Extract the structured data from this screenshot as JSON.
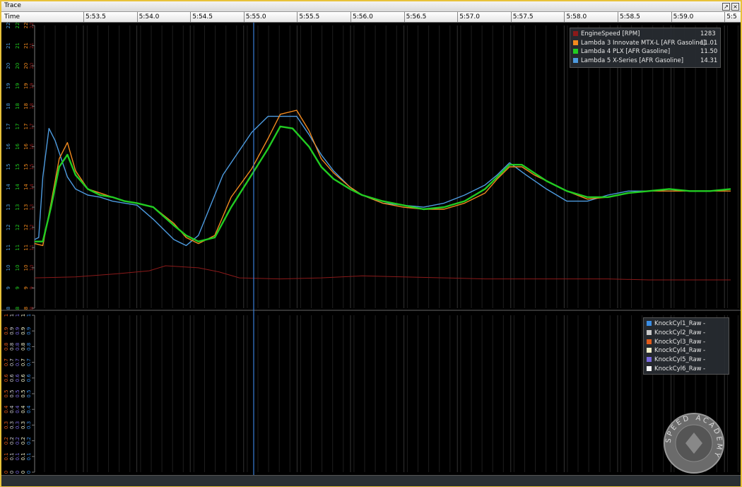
{
  "window": {
    "title": "Trace"
  },
  "timeaxis": {
    "label": "Time",
    "ticks": [
      "5:53.5",
      "5:54.0",
      "5:54.5",
      "5:55.0",
      "5:55.5",
      "5:56.0",
      "5:56.5",
      "5:57.0",
      "5:57.5",
      "5:58.0",
      "5:58.5",
      "5:59.0",
      "5:5"
    ]
  },
  "legend_top": [
    {
      "name": "EngineSpeed [RPM]",
      "value": "1283",
      "color": "#8b1a1a"
    },
    {
      "name": "Lambda 3 Innovate MTX-L [AFR Gasoline]",
      "value": "11.01",
      "color": "#f28a1e"
    },
    {
      "name": "Lambda 4 PLX [AFR Gasoline]",
      "value": "11.50",
      "color": "#22cc22"
    },
    {
      "name": "Lambda 5 X-Series [AFR Gasoline]",
      "value": "14.31",
      "color": "#4d9be0"
    }
  ],
  "legend_bottom": [
    {
      "name": "KnockCyl1_Raw",
      "value": "-",
      "color": "#3a8ee6"
    },
    {
      "name": "KnockCyl2_Raw",
      "value": "-",
      "color": "#c8c8c8"
    },
    {
      "name": "KnockCyl3_Raw",
      "value": "-",
      "color": "#e05a1a"
    },
    {
      "name": "KnockCyl4_Raw",
      "value": "-",
      "color": "#f0efc8"
    },
    {
      "name": "KnockCyl5_Raw",
      "value": "-",
      "color": "#7a6ae0"
    },
    {
      "name": "KnockCyl6_Raw",
      "value": "-",
      "color": "#f4f4f4"
    }
  ],
  "top_axis_labels": [
    "8",
    "9",
    "10",
    "11",
    "12",
    "13",
    "14",
    "15",
    "16",
    "17",
    "18",
    "19",
    "20",
    "21",
    "22"
  ],
  "bottom_axis_labels": [
    "0",
    "0.1",
    "0.2",
    "0.3",
    "0.4",
    "0.5",
    "0.6",
    "0.7",
    "0.8",
    "0.9",
    "1"
  ],
  "watermark": {
    "text": "SPEED ACADEMY"
  },
  "chart_data": {
    "type": "line",
    "x_unit": "time (m:ss.s)",
    "ylim": [
      8,
      22
    ],
    "series": [
      {
        "name": "Lambda 5 X-Series [AFR Gasoline]",
        "x": [
          5.0,
          5.1,
          5.2,
          5.35,
          5.5,
          5.8,
          6.0,
          6.3,
          6.6,
          6.9,
          7.2,
          7.5,
          7.9,
          8.4,
          8.7,
          9.0,
          9.6,
          10.3,
          10.7,
          11.4,
          11.7,
          12.0,
          12.3,
          12.7,
          13.0,
          13.5,
          14.0,
          14.5,
          15.0,
          15.5,
          16.0,
          16.3,
          16.6,
          17.0,
          17.5,
          18.0,
          18.5,
          19.0,
          19.5,
          20.0,
          20.5,
          21.0,
          21.5,
          22.0
        ],
        "y": [
          11.4,
          11.5,
          14.5,
          16.9,
          16.3,
          14.5,
          13.9,
          13.6,
          13.5,
          13.3,
          13.2,
          13.1,
          12.4,
          11.4,
          11.1,
          11.6,
          14.6,
          16.7,
          17.5,
          17.5,
          16.6,
          15.6,
          14.8,
          14.0,
          13.6,
          13.2,
          13.1,
          13.0,
          13.2,
          13.6,
          14.1,
          14.6,
          15.2,
          14.6,
          13.9,
          13.3,
          13.3,
          13.6,
          13.8,
          13.8,
          13.8,
          13.8,
          13.8,
          13.9
        ]
      },
      {
        "name": "Lambda 3 Innovate MTX-L [AFR Gasoline]",
        "x": [
          5.0,
          5.2,
          5.4,
          5.6,
          5.8,
          6.0,
          6.3,
          6.6,
          6.9,
          7.2,
          7.5,
          7.9,
          8.4,
          8.7,
          9.0,
          9.4,
          9.8,
          10.3,
          10.7,
          11.0,
          11.4,
          11.7,
          12.0,
          12.3,
          12.7,
          13.0,
          13.5,
          14.0,
          14.5,
          15.0,
          15.5,
          16.0,
          16.3,
          16.6,
          16.9,
          17.2,
          17.5,
          18.0,
          18.5,
          19.0,
          19.5,
          20.0,
          20.5,
          21.0,
          21.5,
          22.0
        ],
        "y": [
          11.2,
          11.1,
          13.2,
          15.4,
          16.2,
          14.8,
          13.9,
          13.7,
          13.5,
          13.3,
          13.2,
          13.0,
          12.2,
          11.5,
          11.2,
          11.6,
          13.5,
          14.9,
          16.4,
          17.6,
          17.8,
          16.8,
          15.4,
          14.7,
          14.0,
          13.6,
          13.2,
          13.0,
          12.9,
          12.9,
          13.2,
          13.7,
          14.4,
          15.0,
          15.0,
          14.6,
          14.3,
          13.8,
          13.4,
          13.5,
          13.7,
          13.8,
          13.8,
          13.8,
          13.8,
          13.8
        ]
      },
      {
        "name": "Lambda 4 PLX [AFR Gasoline]",
        "x": [
          5.0,
          5.2,
          5.4,
          5.6,
          5.8,
          6.0,
          6.3,
          6.6,
          6.9,
          7.2,
          7.5,
          7.9,
          8.4,
          8.7,
          9.0,
          9.4,
          9.8,
          10.3,
          10.7,
          11.0,
          11.3,
          11.7,
          12.0,
          12.3,
          12.7,
          13.0,
          13.5,
          14.0,
          14.5,
          15.0,
          15.5,
          16.0,
          16.3,
          16.6,
          16.9,
          17.2,
          17.5,
          18.0,
          18.5,
          19.0,
          19.5,
          20.0,
          20.5,
          21.0,
          21.5,
          22.0
        ],
        "y": [
          11.3,
          11.3,
          13.0,
          15.0,
          15.6,
          14.6,
          13.9,
          13.6,
          13.5,
          13.3,
          13.2,
          13.0,
          12.1,
          11.6,
          11.3,
          11.5,
          13.0,
          14.6,
          15.9,
          17.0,
          16.9,
          16.0,
          15.0,
          14.4,
          13.9,
          13.6,
          13.3,
          13.1,
          12.9,
          13.0,
          13.3,
          13.9,
          14.5,
          15.1,
          15.1,
          14.7,
          14.3,
          13.8,
          13.5,
          13.5,
          13.7,
          13.8,
          13.9,
          13.8,
          13.8,
          13.9
        ]
      },
      {
        "name": "EngineSpeed [RPM]",
        "x": [
          5.0,
          6.0,
          7.0,
          7.8,
          8.2,
          9.0,
          9.5,
          10.0,
          11.0,
          12.0,
          13.0,
          14.0,
          15.0,
          16.0,
          17.0,
          18.0,
          19.0,
          20.0,
          21.0,
          22.0
        ],
        "y": [
          9.5,
          9.55,
          9.7,
          9.85,
          10.1,
          10.0,
          9.8,
          9.5,
          9.45,
          9.5,
          9.6,
          9.55,
          9.5,
          9.45,
          9.45,
          9.45,
          9.45,
          9.4,
          9.4,
          9.4
        ]
      }
    ]
  }
}
